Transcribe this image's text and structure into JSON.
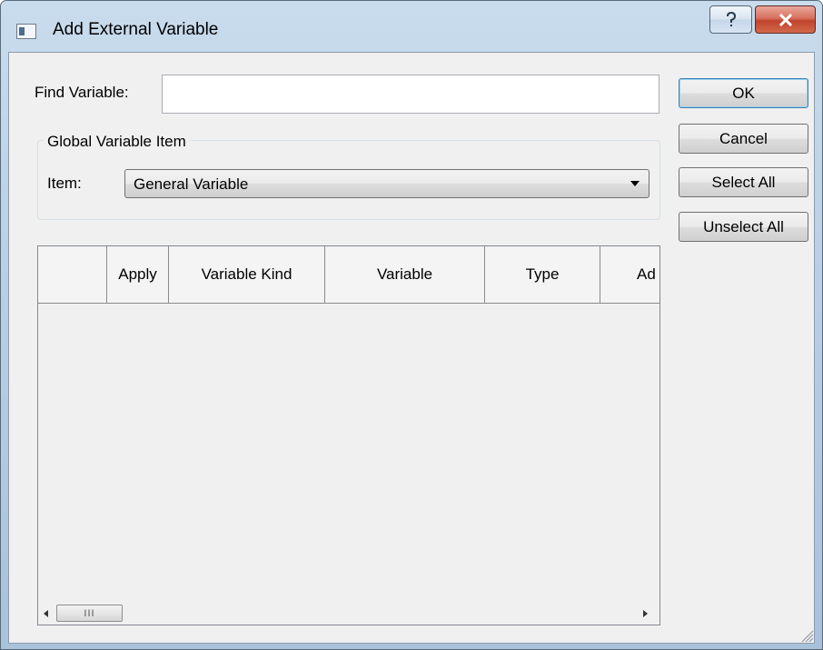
{
  "window": {
    "title": "Add External Variable",
    "help_button": "help",
    "close_button": "close"
  },
  "find": {
    "label": "Find Variable:",
    "value": ""
  },
  "group": {
    "title": "Global Variable Item",
    "item_label": "Item:",
    "item_selected": "General Variable"
  },
  "buttons": {
    "ok": "OK",
    "cancel": "Cancel",
    "select_all": "Select All",
    "unselect_all": "Unselect All"
  },
  "table": {
    "columns": [
      "",
      "Apply",
      "Variable Kind",
      "Variable",
      "Type",
      "Ad"
    ],
    "rows": []
  },
  "scrollbar": {
    "thumb_grip": "III"
  },
  "colors": {
    "title_bar": "#b9d0e6",
    "close_button": "#c0432c",
    "client_bg": "#f0f0f0",
    "default_button_border": "#3c7fb1"
  }
}
